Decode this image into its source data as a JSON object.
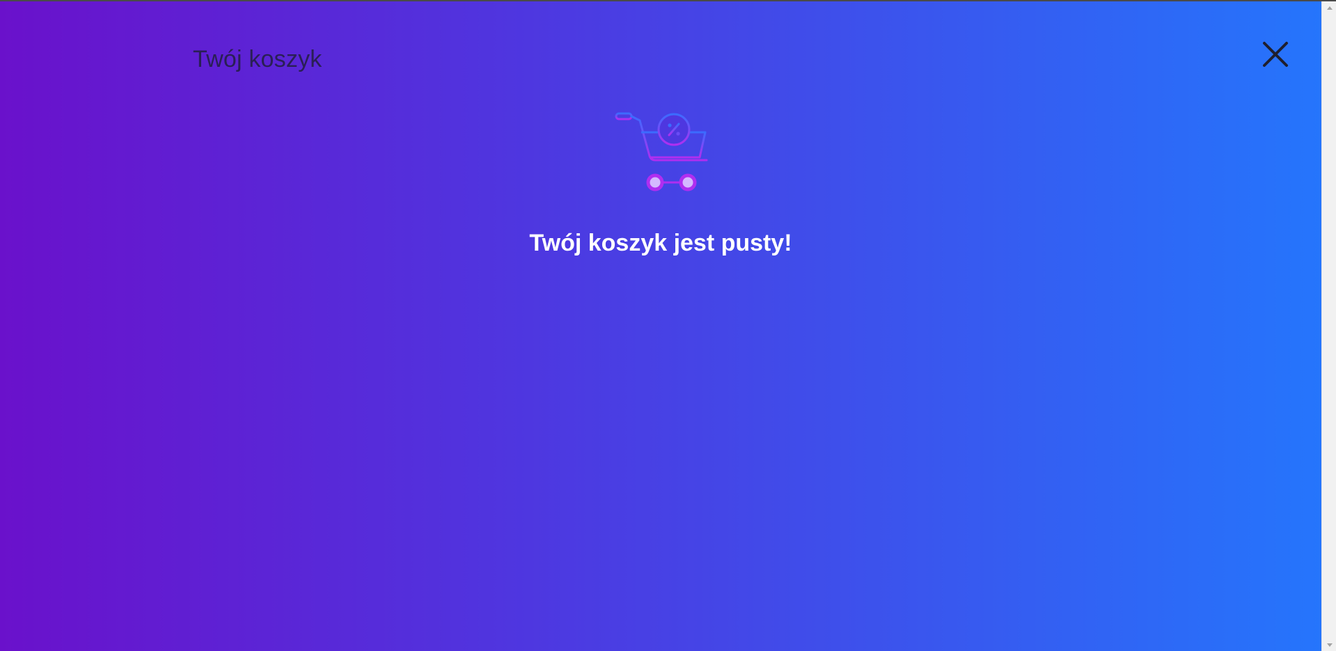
{
  "cart": {
    "title": "Twój koszyk",
    "empty_message": "Twój koszyk jest pusty!",
    "close_icon": "close-icon",
    "illustration_icon": "shopping-cart-discount-icon"
  },
  "colors": {
    "gradient_start": "#6a11cb",
    "gradient_end": "#2575fc",
    "title_text": "#2a1f55",
    "message_text": "#ffffff",
    "icon_accent": "#b02ef0"
  }
}
